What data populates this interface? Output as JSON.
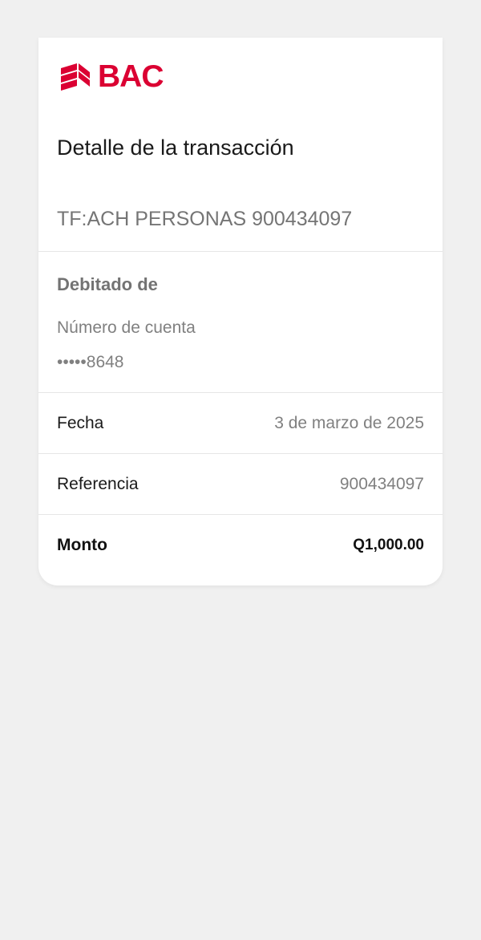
{
  "brand": {
    "name": "BAC",
    "logo_icon": "bac-logo-icon",
    "color": "#db0032"
  },
  "header": {
    "title": "Detalle de la transacción"
  },
  "transaction": {
    "description": "TF:ACH PERSONAS 900434097"
  },
  "debit": {
    "heading": "Debitado de",
    "account_label": "Número de cuenta",
    "account_value": "•••••8648"
  },
  "details": {
    "date_label": "Fecha",
    "date_value": "3 de marzo de 2025",
    "reference_label": "Referencia",
    "reference_value": "900434097",
    "amount_label": "Monto",
    "amount_value": "Q1,000.00"
  },
  "colors": {
    "background": "#f0f0f0",
    "card": "#ffffff",
    "accent": "#db0032"
  }
}
